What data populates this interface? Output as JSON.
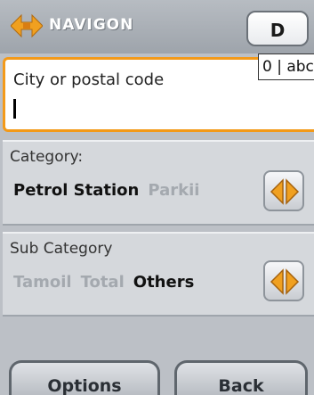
{
  "header": {
    "brand": "NAVIGON",
    "key_label": "D",
    "input_mode": "0 | abc"
  },
  "search": {
    "placeholder": "City or postal code",
    "value": ""
  },
  "category": {
    "label": "Category:",
    "options": [
      "Petrol Station",
      "Parkii"
    ],
    "selected": "Petrol Station"
  },
  "subcategory": {
    "label": "Sub Category",
    "options": [
      "Tamoil",
      "Total",
      "Others"
    ],
    "selected": "Others"
  },
  "buttons": {
    "options_label": "Options",
    "back_label": "Back"
  },
  "colors": {
    "accent": "#f39a1a",
    "background": "#bcc0c6",
    "arrow": "#f0a020"
  },
  "icons": {
    "logo": "navigon-logo-icon",
    "arrows": "left-right-arrows-icon"
  }
}
